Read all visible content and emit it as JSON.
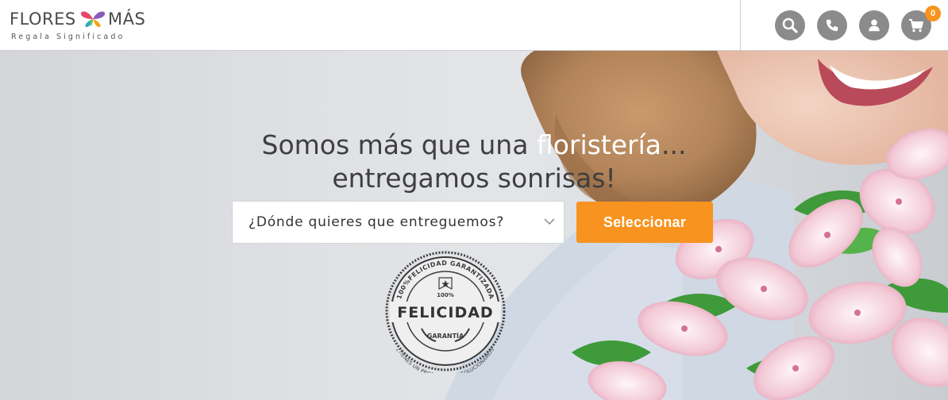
{
  "header": {
    "logo": {
      "word_left": "FLORES",
      "word_right": "MÁS",
      "tagline": "Regala Significado"
    },
    "icons": [
      {
        "name": "search-icon"
      },
      {
        "name": "phone-icon"
      },
      {
        "name": "user-icon"
      },
      {
        "name": "cart-icon"
      }
    ],
    "cart_count": "0"
  },
  "hero": {
    "headline_part1": "Somos más que una ",
    "headline_highlight": "floristería",
    "headline_part2": "...",
    "headline_line2": "entregamos sonrisas!",
    "location_select": {
      "placeholder": "¿Dónde quieres que entreguemos?"
    },
    "cta_label": "Seleccionar",
    "seal": {
      "top_arc": "100%FELICIDAD GARANTIZADA",
      "percent": "100%",
      "main": "FELICIDAD",
      "ribbon": "GARANTÍA",
      "bottom_arc": "¿TIENES UN PROBLEMA? LO SOLUCIONAMOS"
    }
  },
  "colors": {
    "accent": "#f7931e",
    "icon_bg": "#8b8b8b",
    "text_dark": "#3f3f3f",
    "highlight": "#ffffff"
  }
}
